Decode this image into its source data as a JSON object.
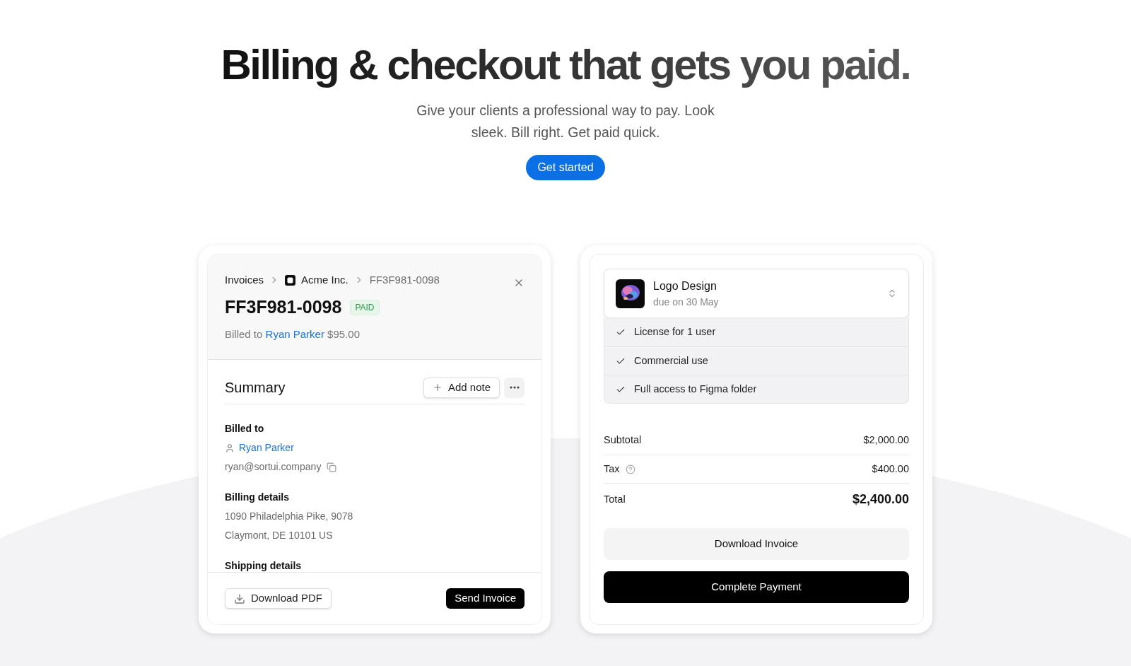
{
  "hero": {
    "title": "Billing & checkout that gets you paid.",
    "subtitle": "Give your clients a professional way to pay. Look sleek. Bill right. Get paid quick.",
    "cta": "Get started"
  },
  "invoice": {
    "breadcrumbs": [
      {
        "label": "Invoices",
        "kind": "text"
      },
      {
        "label": "Acme Inc.",
        "kind": "company"
      },
      {
        "label": "FF3F981-0098",
        "kind": "current"
      }
    ],
    "number": "FF3F981-0098",
    "status": "PAID",
    "billed_prefix": "Billed to",
    "billed_name": "Ryan Parker",
    "amount": "$95.00",
    "summary_title": "Summary",
    "add_note": "Add note",
    "sections": [
      {
        "heading": "Billed to",
        "kind": "contact",
        "name": "Ryan Parker",
        "email": "ryan@sortui.company"
      },
      {
        "heading": "Billing details",
        "kind": "address",
        "lines": [
          "1090 Philadelphia Pike, 9078",
          "Claymont, DE 10101 US"
        ]
      },
      {
        "heading": "Shipping details",
        "kind": "address"
      }
    ],
    "download": "Download PDF",
    "send": "Send Invoice"
  },
  "checkout": {
    "product": "Logo Design",
    "due": "due on 30 May",
    "features": [
      {
        "label": "License for 1 user",
        "checked": true
      },
      {
        "label": "Commercial use",
        "checked": true
      },
      {
        "label": "Full access to Figma folder",
        "checked": true
      }
    ],
    "lines": [
      {
        "label": "Subtotal",
        "value": "$2,000.00",
        "kind": "plain"
      },
      {
        "label": "Tax",
        "value": "$400.00",
        "kind": "info"
      },
      {
        "label": "Total",
        "value": "$2,400.00",
        "kind": "total"
      }
    ],
    "download": "Download Invoice",
    "pay": "Complete Payment"
  }
}
